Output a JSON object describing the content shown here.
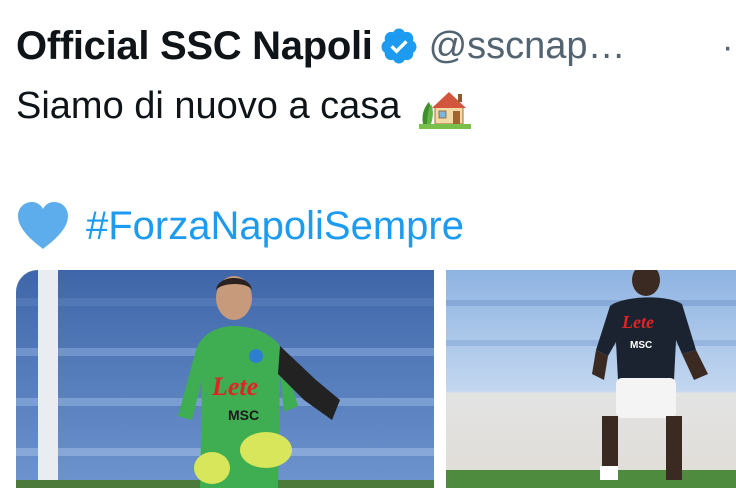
{
  "tweet": {
    "display_name": "Official SSC Napoli",
    "handle": "@sscnap…",
    "separator": "·",
    "verified_icon": "verified-badge-icon",
    "text": "Siamo di nuovo a casa",
    "text_emoji": "house-with-garden-icon",
    "heart_emoji": "blue-heart-icon",
    "hashtag": "#ForzaNapoliSempre"
  },
  "media": {
    "photos": [
      {
        "name": "goalkeeper-warmup-photo",
        "kit_sponsor": "Lete",
        "kit_badge": "MSC"
      },
      {
        "name": "outfield-player-warmup-photo",
        "kit_sponsor": "Lete",
        "kit_badge": "MSC"
      }
    ]
  },
  "colors": {
    "text": "#0f1419",
    "secondary": "#536471",
    "link": "#1d9bf0",
    "verified": "#1d9bf0",
    "heart": "#5dadec"
  }
}
